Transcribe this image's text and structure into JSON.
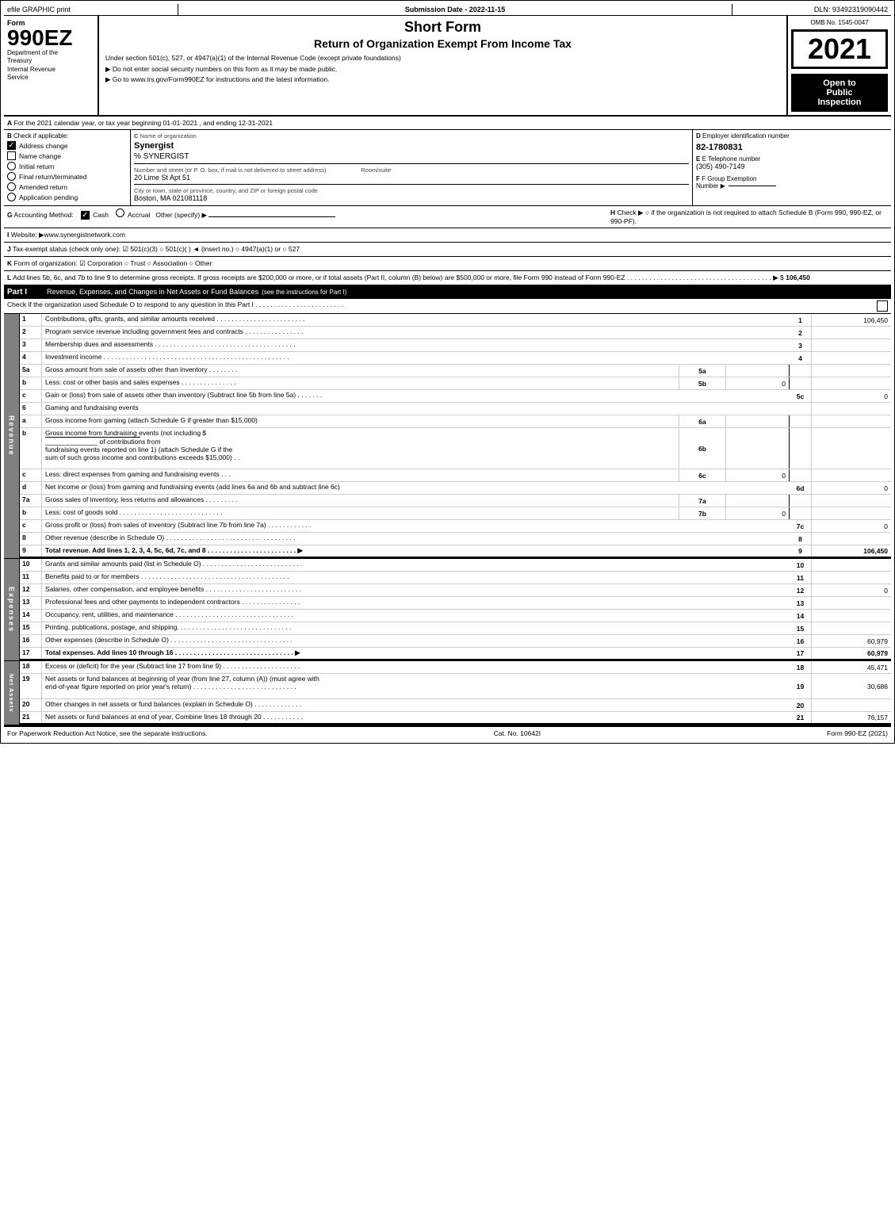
{
  "header": {
    "app_label": "efile GRAPHIC print",
    "submission_date_label": "Submission Date - 2022-11-15",
    "dln": "DLN: 93492319090442",
    "omb": "OMB No. 1545-0047",
    "form_number": "990EZ",
    "form_dept1": "Department of the",
    "form_dept2": "Treasury",
    "form_dept3": "Internal Revenue",
    "form_dept4": "Service",
    "title_main": "Short Form",
    "title_sub": "Return of Organization Exempt From Income Tax",
    "inst1": "Under section 501(c), 527, or 4947(a)(1) of the Internal Revenue Code (except private foundations)",
    "inst2": "▶ Do not enter social security numbers on this form as it may be made public.",
    "inst3": "▶ Go to www.irs.gov/Form990EZ for instructions and the latest information.",
    "year": "2021",
    "open_public": "Open to\nPublic\nInspection"
  },
  "section_a": {
    "label": "A",
    "text": "For the 2021 calendar year, or tax year beginning 01-01-2021 , and ending 12-31-2021"
  },
  "section_b": {
    "label": "B",
    "label_text": "Check if applicable:",
    "address_change": "Address change",
    "address_change_checked": true,
    "name_change": "Name change",
    "name_change_checked": false,
    "initial_return": "Initial return",
    "initial_return_checked": false,
    "final_return": "Final return/terminated",
    "final_return_checked": false,
    "amended_return": "Amended return",
    "amended_return_checked": false,
    "application_pending": "Application pending",
    "application_pending_checked": false
  },
  "section_c": {
    "label": "C",
    "name_label": "Name of organization",
    "org_name": "Synergist",
    "org_name2": "% SYNERGIST",
    "addr_label": "Number and street (or P. O. box, if mail is not delivered to street address)",
    "addr_value": "20 Lime St Apt 51",
    "room_label": "Room/suite",
    "room_value": "",
    "city_label": "City or town, state or province, country, and ZIP or foreign postal code",
    "city_value": "Boston, MA  021081118"
  },
  "section_d": {
    "label": "D",
    "ein_label": "Employer identification number",
    "ein_value": "82-1780831",
    "phone_label": "E Telephone number",
    "phone_value": "(305) 490-7149",
    "group_label": "F Group Exemption",
    "group_label2": "Number",
    "group_arrow": "▶"
  },
  "section_g": {
    "label": "G",
    "text": "Accounting Method:",
    "cash_label": "Cash",
    "cash_checked": true,
    "accrual_label": "Accrual",
    "accrual_checked": false,
    "other_label": "Other (specify) ▶",
    "other_line": "___________________________"
  },
  "section_h": {
    "label": "H",
    "text": "Check ▶",
    "desc": "○ if the organization is not required to attach Schedule B (Form 990, 990-EZ, or 990-PF)."
  },
  "section_i": {
    "label": "I",
    "text": "Website: ▶www.synergistnetwork.com"
  },
  "section_j": {
    "label": "J",
    "text": "Tax-exempt status (check only one): ☑ 501(c)(3) ○ 501(c)( ) ◄ (insert no.) ○ 4947(a)(1) or ○ 527"
  },
  "section_k": {
    "label": "K",
    "text": "Form of organization: ☑ Corporation  ○ Trust  ○ Association  ○ Other"
  },
  "section_l": {
    "label": "L",
    "text": "Add lines 5b, 6c, and 7b to line 9 to determine gross receipts. If gross receipts are $200,000 or more, or if total assets (Part II, column (B) below) are $500,000 or more, file Form 990 instead of Form 990-EZ . . . . . . . . . . . . . . . . . . . . . . . . . . . . . . . . . . . . . . . ▶ $",
    "value": "106,450"
  },
  "part1": {
    "label": "Part I",
    "title": "Revenue, Expenses, and Changes in Net Assets or Fund Balances",
    "subtitle": "(see the instructions for Part I)",
    "check_text": "Check if the organization used Schedule O to respond to any question in this Part I . . . . . . . . . . . . . . . . . . . . . . . .",
    "rows": [
      {
        "num": "1",
        "desc": "Contributions, gifts, grants, and similar amounts received . . . . . . . . . . . . . . . . . . . . . . . .",
        "line": "1",
        "value": "106,450"
      },
      {
        "num": "2",
        "desc": "Program service revenue including government fees and contracts . . . . . . . . . . . . . . . .",
        "line": "2",
        "value": ""
      },
      {
        "num": "3",
        "desc": "Membership dues and assessments . . . . . . . . . . . . . . . . . . . . . . . . . . . . . . . . . . . . . .",
        "line": "3",
        "value": ""
      },
      {
        "num": "4",
        "desc": "Investment income . . . . . . . . . . . . . . . . . . . . . . . . . . . . . . . . . . . . . . . . . . . . . . . . . .",
        "line": "4",
        "value": ""
      }
    ],
    "row5a": {
      "num": "5a",
      "desc": "Gross amount from sale of assets other than inventory . . . . . . . .",
      "sub_col": "5a",
      "sub_val": ""
    },
    "row5b": {
      "num": "b",
      "desc": "Less: cost or other basis and sales expenses . . . . . . . . . . . . . . .",
      "sub_col": "5b",
      "sub_val": "0"
    },
    "row5c": {
      "num": "c",
      "desc": "Gain or (loss) from sale of assets other than inventory (Subtract line 5b from line 5a) . . . . . . .",
      "line": "5c",
      "value": "0"
    },
    "row6": {
      "num": "6",
      "desc": "Gaming and fundraising events"
    },
    "row6a": {
      "num": "a",
      "desc": "Gross income from gaming (attach Schedule G if greater than $15,000)",
      "sub_col": "6a",
      "sub_val": ""
    },
    "row6b_desc1": "Gross income from fundraising events (not including $",
    "row6b_desc2": "______________ of contributions from",
    "row6b_desc3": "fundraising events reported on line 1) (attach Schedule G if the",
    "row6b_desc4": "sum of such gross income and contributions exceeds $15,000)  .  .",
    "row6b_sub_col": "6b",
    "row6c": {
      "num": "c",
      "desc": "Less: direct expenses from gaming and fundraising events    .   .   .",
      "sub_col": "6c",
      "sub_val": "0"
    },
    "row6d": {
      "num": "d",
      "desc": "Net income or (loss) from gaming and fundraising events (add lines 6a and 6b and subtract line 6c)",
      "line": "6d",
      "value": "0"
    },
    "row7a": {
      "num": "7a",
      "desc": "Gross sales of inventory, less returns and allowances . . . . . . . . .",
      "sub_col": "7a",
      "sub_val": ""
    },
    "row7b": {
      "num": "b",
      "desc": "Less: cost of goods sold  .  .  .  .  .  .  .  .  .  .  .  .  .  .  .  .  .  .  .  .  .  .  .  .  .  .  .  .",
      "sub_col": "7b",
      "sub_val": "0"
    },
    "row7c": {
      "num": "c",
      "desc": "Gross profit or (loss) from sales of inventory (Subtract line 7b from line 7a) . . . . . . . . . . . .",
      "line": "7c",
      "value": "0"
    },
    "row8": {
      "num": "8",
      "desc": "Other revenue (describe in Schedule O) . . . . . . . . . . . . . . . . . . . . . . . . . . . . . . . . . . .",
      "line": "8",
      "value": ""
    },
    "row9": {
      "num": "9",
      "desc": "Total revenue. Add lines 1, 2, 3, 4, 5c, 6d, 7c, and 8 . . . . . . . . . . . . . . . . . . . . . . . . ▶",
      "line": "9",
      "value": "106,450",
      "bold": true
    }
  },
  "expenses": {
    "rows": [
      {
        "num": "10",
        "desc": "Grants and similar amounts paid (list in Schedule O) . . . . . . . . . . . . . . . . . . . . . . . . . . .",
        "line": "10",
        "value": ""
      },
      {
        "num": "11",
        "desc": "Benefits paid to or for members  . . . . . . . . . . . . . . . . . . . . . . . . . . . . . . . . . . . . . . . .",
        "line": "11",
        "value": ""
      },
      {
        "num": "12",
        "desc": "Salaries, other compensation, and employee benefits . . . . . . . . . . . . . . . . . . . . . . . . . .",
        "line": "12",
        "value": "0"
      },
      {
        "num": "13",
        "desc": "Professional fees and other payments to independent contractors . . . . . . . . . . . . . . . .",
        "line": "13",
        "value": ""
      },
      {
        "num": "14",
        "desc": "Occupancy, rent, utilities, and maintenance . . . . . . . . . . . . . . . . . . . . . . . . . . . . . . . .",
        "line": "14",
        "value": ""
      },
      {
        "num": "15",
        "desc": "Printing, publications, postage, and shipping. . . . . . . . . . . . . . . . . . . . . . . . . . . . . . .",
        "line": "15",
        "value": ""
      },
      {
        "num": "16",
        "desc": "Other expenses (describe in Schedule O) . . . . . . . . . . . . . . . . . . . . . . . . . . . . . . . . .",
        "line": "16",
        "value": "60,979"
      },
      {
        "num": "17",
        "desc": "Total expenses. Add lines 10 through 16  . . . . . . . . . . . . . . . . . . . . . . . . . . . . . . . . ▶",
        "line": "17",
        "value": "60,979",
        "bold": true
      }
    ]
  },
  "net_assets": {
    "rows": [
      {
        "num": "18",
        "desc": "Excess or (deficit) for the year (Subtract line 17 from line 9) . . . . . . . . . . . . . . . . . . . . .",
        "line": "18",
        "value": "45,471"
      },
      {
        "num": "19",
        "desc": "Net assets or fund balances at beginning of year (from line 27, column (A)) (must agree with\nend-of-year figure reported on prior year's return) . . . . . . . . . . . . . . . . . . . . . . . . . . . .",
        "line": "19",
        "value": "30,686"
      },
      {
        "num": "20",
        "desc": "Other changes in net assets or fund balances (explain in Schedule O) . . . . . . . . . . . . .",
        "line": "20",
        "value": ""
      },
      {
        "num": "21",
        "desc": "Net assets or fund balances at end of year. Combine lines 18 through 20 . . . . . . . . . . .",
        "line": "21",
        "value": "76,157"
      }
    ]
  },
  "footer": {
    "left": "For Paperwork Reduction Act Notice, see the separate instructions.",
    "cat": "Cat. No. 10642I",
    "right": "Form 990-EZ (2021)"
  }
}
